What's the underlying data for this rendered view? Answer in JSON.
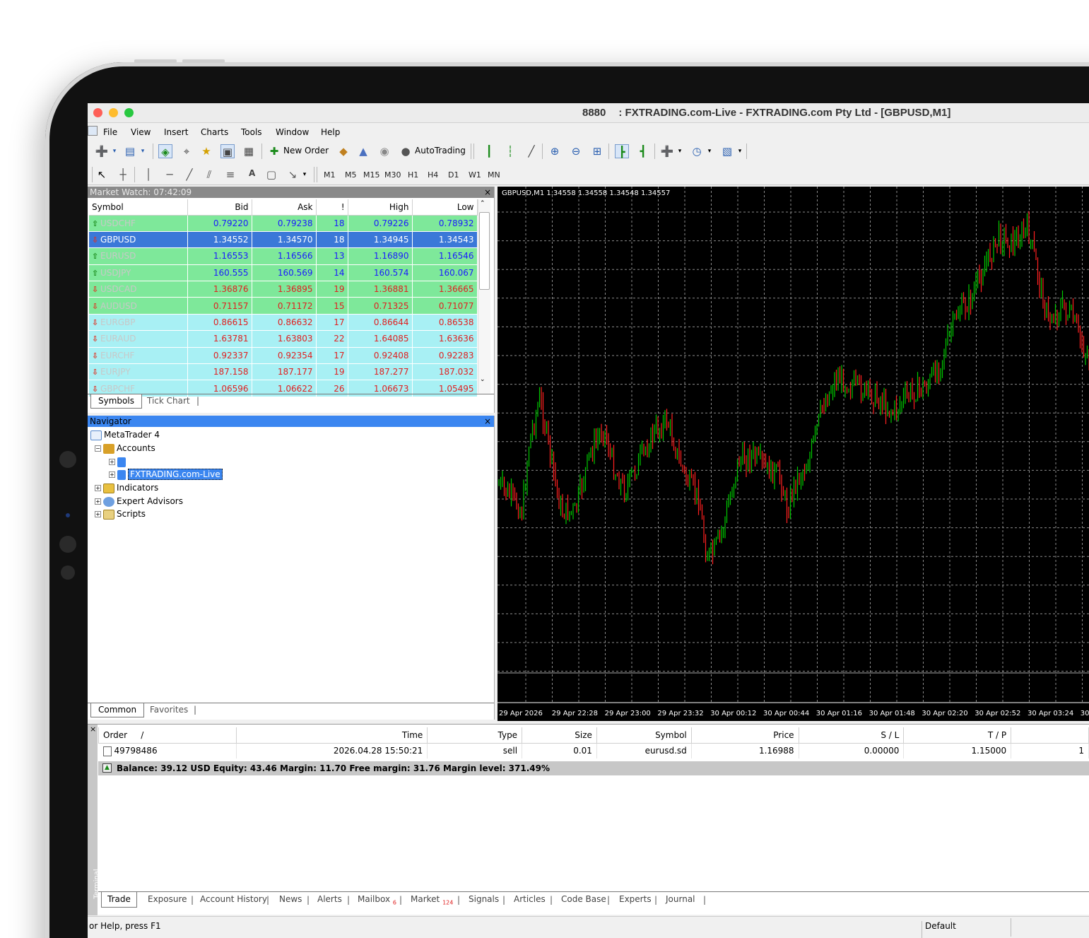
{
  "window": {
    "title": "8880      : FXTRADING.com-Live - FXTRADING.com Pty Ltd - [GBPUSD,M1]"
  },
  "menu": {
    "file": "File",
    "view": "View",
    "insert": "Insert",
    "charts": "Charts",
    "tools": "Tools",
    "window": "Window",
    "help": "Help"
  },
  "toolbar": {
    "new_order": "New Order",
    "autotrading": "AutoTrading",
    "text_tool": "A",
    "timeframes": [
      "M1",
      "M5",
      "M15",
      "M30",
      "H1",
      "H4",
      "D1",
      "W1",
      "MN"
    ]
  },
  "market_watch": {
    "title": "Market Watch: 07:42:09",
    "columns": [
      "Symbol",
      "Bid",
      "Ask",
      "!",
      "High",
      "Low"
    ],
    "rows": [
      {
        "symbol": "USDCHF",
        "bid": "0.79220",
        "ask": "0.79238",
        "spread": "18",
        "high": "0.79226",
        "low": "0.78932",
        "dir": "up",
        "bg": "green"
      },
      {
        "symbol": "GBPUSD",
        "bid": "1.34552",
        "ask": "1.34570",
        "spread": "18",
        "high": "1.34945",
        "low": "1.34543",
        "dir": "down",
        "bg": "selected"
      },
      {
        "symbol": "EURUSD",
        "bid": "1.16553",
        "ask": "1.16566",
        "spread": "13",
        "high": "1.16890",
        "low": "1.16546",
        "dir": "up",
        "bg": "green"
      },
      {
        "symbol": "USDJPY",
        "bid": "160.555",
        "ask": "160.569",
        "spread": "14",
        "high": "160.574",
        "low": "160.067",
        "dir": "up",
        "bg": "green"
      },
      {
        "symbol": "USDCAD",
        "bid": "1.36876",
        "ask": "1.36895",
        "spread": "19",
        "high": "1.36881",
        "low": "1.36665",
        "dir": "down",
        "bg": "green"
      },
      {
        "symbol": "AUDUSD",
        "bid": "0.71157",
        "ask": "0.71172",
        "spread": "15",
        "high": "0.71325",
        "low": "0.71077",
        "dir": "down",
        "bg": "green"
      },
      {
        "symbol": "EURGBP",
        "bid": "0.86615",
        "ask": "0.86632",
        "spread": "17",
        "high": "0.86644",
        "low": "0.86538",
        "dir": "down",
        "bg": "cyan"
      },
      {
        "symbol": "EURAUD",
        "bid": "1.63781",
        "ask": "1.63803",
        "spread": "22",
        "high": "1.64085",
        "low": "1.63636",
        "dir": "down",
        "bg": "cyan"
      },
      {
        "symbol": "EURCHF",
        "bid": "0.92337",
        "ask": "0.92354",
        "spread": "17",
        "high": "0.92408",
        "low": "0.92283",
        "dir": "down",
        "bg": "cyan"
      },
      {
        "symbol": "EURJPY",
        "bid": "187.158",
        "ask": "187.177",
        "spread": "19",
        "high": "187.277",
        "low": "187.032",
        "dir": "down",
        "bg": "cyan"
      },
      {
        "symbol": "GBPCHF",
        "bid": "1.06596",
        "ask": "1.06622",
        "spread": "26",
        "high": "1.06673",
        "low": "1.05495",
        "dir": "down",
        "bg": "cyan"
      }
    ],
    "tabs": [
      "Symbols",
      "Tick Chart"
    ]
  },
  "navigator": {
    "title": "Navigator",
    "root": "MetaTrader 4",
    "accounts": "Accounts",
    "account_live": "FXTRADING.com-Live",
    "indicators": "Indicators",
    "expert_advisors": "Expert Advisors",
    "scripts": "Scripts",
    "tabs": [
      "Common",
      "Favorites"
    ]
  },
  "chart": {
    "header": "GBPUSD,M1  1.34558 1.34558 1.34548 1.34557",
    "time_labels": [
      "29 Apr 2026",
      "29 Apr 22:28",
      "29 Apr 23:00",
      "29 Apr 23:32",
      "30 Apr 00:12",
      "30 Apr 00:44",
      "30 Apr 01:16",
      "30 Apr 01:48",
      "30 Apr 02:20",
      "30 Apr 02:52",
      "30 Apr 03:24",
      "30"
    ],
    "bull_color": "#00c800",
    "bear_color": "#ff2020",
    "grid_color": "#8a8a8a"
  },
  "terminal": {
    "side_label": "Terminal",
    "columns": [
      "Order",
      "/",
      "Time",
      "Type",
      "Size",
      "Symbol",
      "Price",
      "S / L",
      "T / P"
    ],
    "order": {
      "id": "49798486",
      "time": "2026.04.28 15:50:21",
      "type": "sell",
      "size": "0.01",
      "symbol": "eurusd.sd",
      "price": "1.16988",
      "sl": "0.00000",
      "tp": "1.15000",
      "extra": "1"
    },
    "balance_line": "Balance: 39.12 USD  Equity: 43.46  Margin: 11.70  Free margin: 31.76  Margin level: 371.49%",
    "tabs": {
      "trade": "Trade",
      "exposure": "Exposure",
      "account_history": "Account History",
      "news": "News",
      "alerts": "Alerts",
      "mailbox": "Mailbox",
      "mailbox_count": "6",
      "market": "Market",
      "market_count": "124",
      "signals": "Signals",
      "articles": "Articles",
      "code_base": "Code Base",
      "experts": "Experts",
      "journal": "Journal"
    }
  },
  "status": {
    "help": "or Help, press F1",
    "profile": "Default"
  }
}
